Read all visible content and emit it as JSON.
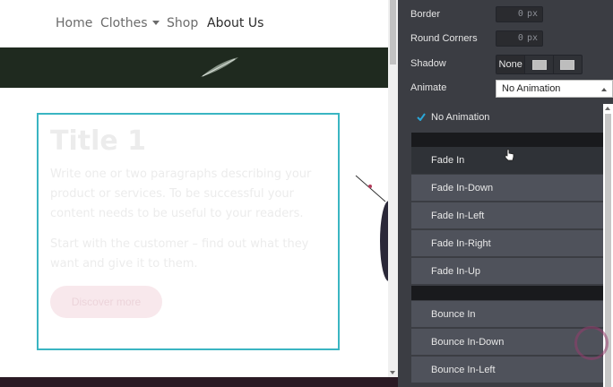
{
  "nav": {
    "items": [
      {
        "label": "Home",
        "dropdown": false
      },
      {
        "label": "Clothes",
        "dropdown": true
      },
      {
        "label": "Shop",
        "dropdown": false
      },
      {
        "label": "About Us",
        "dropdown": false,
        "active": true
      }
    ]
  },
  "card": {
    "title": "Title 1",
    "paragraph1": "Write one or two paragraphs describing your product or services. To be successful your content needs to be useful to your readers.",
    "paragraph2": "Start with the customer – find out what they want and give it to them.",
    "button_label": "Discover more"
  },
  "panel": {
    "border": {
      "label": "Border",
      "value": "0",
      "unit": "px"
    },
    "round_corners": {
      "label": "Round Corners",
      "value": "0",
      "unit": "px"
    },
    "shadow": {
      "label": "Shadow",
      "none_label": "None"
    },
    "animate": {
      "label": "Animate",
      "selected": "No Animation"
    }
  },
  "dropdown": {
    "selected": "No Animation",
    "group1": [
      "Fade In",
      "Fade In-Down",
      "Fade In-Left",
      "Fade In-Right",
      "Fade In-Up"
    ],
    "group2": [
      "Bounce In",
      "Bounce In-Down",
      "Bounce In-Left"
    ]
  },
  "colors": {
    "accent": "#3ab5c2",
    "panel_bg": "#3b3d43",
    "menu_item_bg": "#4f525b",
    "check": "#2aa7d8"
  }
}
